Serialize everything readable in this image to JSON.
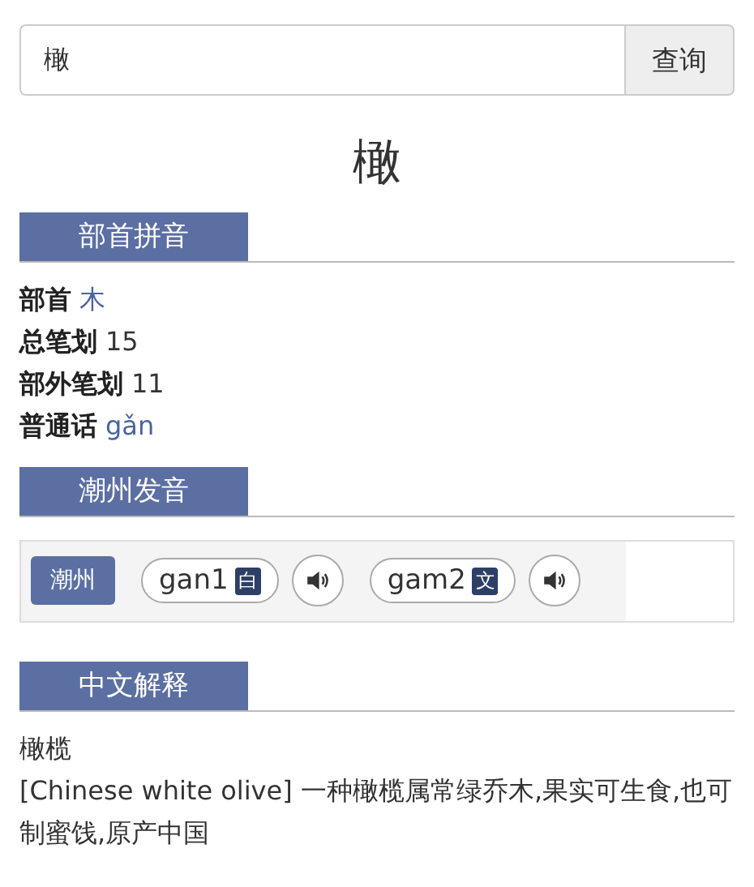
{
  "search": {
    "value": "橄",
    "button": "查询"
  },
  "headword": "橄",
  "sections": [
    {
      "kind": "info",
      "heading": "部首拼音",
      "rows": [
        {
          "label": "部首",
          "value": "木",
          "linked": true
        },
        {
          "label": "总笔划",
          "value": "15",
          "linked": false
        },
        {
          "label": "部外笔划",
          "value": "11",
          "linked": false
        },
        {
          "label": "普通话",
          "value": "gǎn",
          "linked": true
        }
      ]
    },
    {
      "kind": "pron",
      "heading": "潮州发音",
      "dialects": [
        {
          "name": "潮州",
          "readings": [
            {
              "text": "gan1",
              "tag": "白"
            },
            {
              "text": "gam2",
              "tag": "文"
            }
          ]
        }
      ]
    },
    {
      "kind": "definition",
      "heading": "中文解释",
      "lines": [
        "橄榄",
        "[Chinese white olive] 一种橄榄属常绿乔木,果实可生食,也可制蜜饯,原产中国"
      ]
    }
  ]
}
